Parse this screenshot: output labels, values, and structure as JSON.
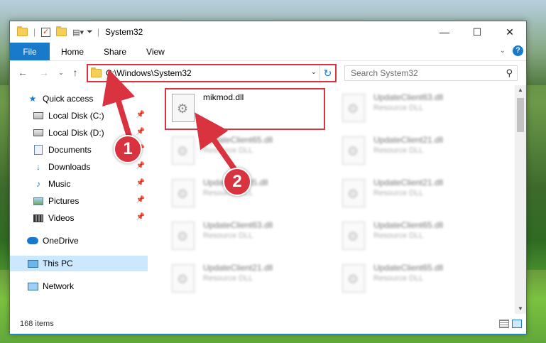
{
  "window": {
    "title": "System32",
    "controls": [
      "—",
      "☐",
      "✕"
    ]
  },
  "ribbon": {
    "tabs": [
      "File",
      "Home",
      "Share",
      "View"
    ],
    "help": "?"
  },
  "address": {
    "path": "C:\\Windows\\System32"
  },
  "search": {
    "placeholder": "Search System32"
  },
  "sidebar": {
    "items": [
      {
        "label": "Quick access",
        "icon": "star-icon"
      },
      {
        "label": "Local Disk (C:)",
        "icon": "disk-icon",
        "pinned": true
      },
      {
        "label": "Local Disk (D:)",
        "icon": "disk-icon",
        "pinned": true
      },
      {
        "label": "Documents",
        "icon": "documents-icon",
        "pinned": true
      },
      {
        "label": "Downloads",
        "icon": "downloads-icon",
        "pinned": true
      },
      {
        "label": "Music",
        "icon": "music-icon",
        "pinned": true
      },
      {
        "label": "Pictures",
        "icon": "pictures-icon",
        "pinned": true
      },
      {
        "label": "Videos",
        "icon": "videos-icon",
        "pinned": true
      },
      {
        "label": "OneDrive",
        "icon": "onedrive-icon"
      },
      {
        "label": "This PC",
        "icon": "this-pc-icon",
        "selected": true
      },
      {
        "label": "Network",
        "icon": "network-icon"
      }
    ]
  },
  "files": [
    {
      "name": "mikmod.dll",
      "type": "",
      "highlighted": true
    },
    {
      "name": "UpdateClient63.dll",
      "type": "Resource DLL"
    },
    {
      "name": "UpdateClient65.dll",
      "type": "Resource DLL"
    },
    {
      "name": "UpdateClient21.dll",
      "type": "Resource DLL"
    },
    {
      "name": "UpdateClient5.dll",
      "type": "Resource DLL"
    },
    {
      "name": "UpdateClient21.dll",
      "type": "Resource DLL"
    },
    {
      "name": "UpdateClient63.dll",
      "type": "Resource DLL"
    },
    {
      "name": "UpdateClient65.dll",
      "type": "Resource DLL"
    },
    {
      "name": "UpdateClient21.dll",
      "type": "Resource DLL"
    },
    {
      "name": "UpdateClient65.dll",
      "type": "Resource DLL"
    }
  ],
  "status": {
    "items_count": "168 items"
  },
  "annotations": {
    "step1": "1",
    "step2": "2",
    "color": "#d9333f"
  }
}
